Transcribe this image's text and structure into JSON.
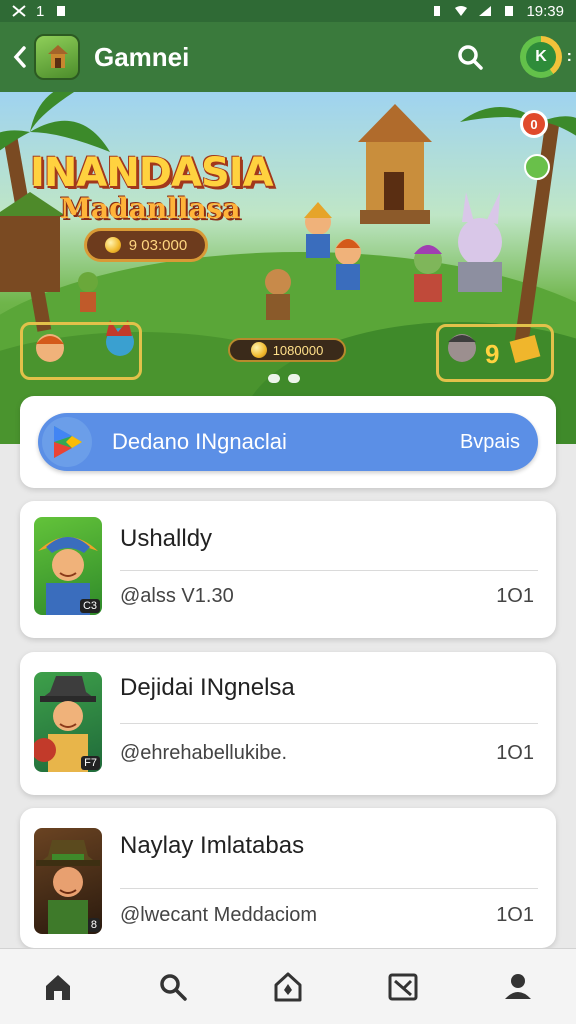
{
  "status_bar": {
    "time": "19:39",
    "left_text": "1"
  },
  "app_bar": {
    "title": "Gamnei",
    "profile_initial": "K"
  },
  "banner": {
    "title": "INANDASIA",
    "subtitle": "Madanllasa",
    "coin_value": "9 03:000",
    "score_value": "1080000",
    "notif_count": "0",
    "right_card_number": "9"
  },
  "search": {
    "label": "Dedano INgnaclai",
    "right_label": "Bvpais"
  },
  "games": [
    {
      "name": "Ushalldy",
      "subtitle": "@alss V1.30",
      "count": "1O1",
      "thumb_badge": "C3"
    },
    {
      "name": "Dejidai INgnelsa",
      "subtitle": "@ehrehabellukibe.",
      "count": "1O1",
      "thumb_badge": "F7"
    },
    {
      "name": "Naylay Imlatabas",
      "subtitle": "@lwecant Meddaciom",
      "count": "1O1",
      "thumb_badge": "8"
    }
  ],
  "bottom_nav": [
    "home-icon",
    "search-icon",
    "store-icon",
    "library-icon",
    "profile-icon"
  ]
}
